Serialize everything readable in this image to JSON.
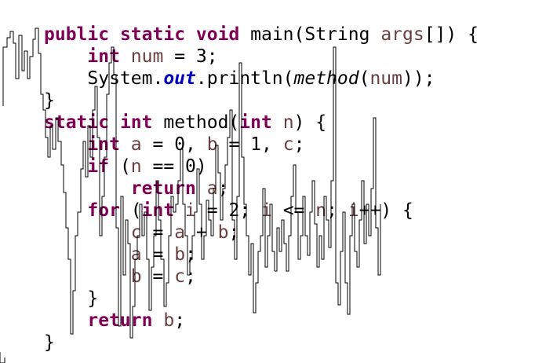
{
  "colors": {
    "background": "#ffffff",
    "keyword": "#7f0055",
    "local_variable": "#6a3e3e",
    "static_field": "#0000c0",
    "plain_text": "#000000",
    "overlay_stroke": "#000000"
  },
  "code": {
    "lines": [
      [
        {
          "t": "public",
          "c": "kw"
        },
        {
          "t": " "
        },
        {
          "t": "static",
          "c": "kw"
        },
        {
          "t": " "
        },
        {
          "t": "void",
          "c": "kw"
        },
        {
          "t": " main(String "
        },
        {
          "t": "args",
          "c": "var"
        },
        {
          "t": "[]) {"
        }
      ],
      [
        {
          "t": "    "
        },
        {
          "t": "int",
          "c": "kw"
        },
        {
          "t": " "
        },
        {
          "t": "num",
          "c": "var"
        },
        {
          "t": " = 3;"
        }
      ],
      [
        {
          "t": "    System."
        },
        {
          "t": "out",
          "c": "field"
        },
        {
          "t": ".println("
        },
        {
          "t": "method",
          "c": "mcall"
        },
        {
          "t": "("
        },
        {
          "t": "num",
          "c": "var"
        },
        {
          "t": "));"
        }
      ],
      [
        {
          "t": "}"
        }
      ],
      [
        {
          "t": "static",
          "c": "kw"
        },
        {
          "t": " "
        },
        {
          "t": "int",
          "c": "kw"
        },
        {
          "t": " method("
        },
        {
          "t": "int",
          "c": "kw"
        },
        {
          "t": " "
        },
        {
          "t": "n",
          "c": "var"
        },
        {
          "t": ") {"
        }
      ],
      [
        {
          "t": "    "
        },
        {
          "t": "int",
          "c": "kw"
        },
        {
          "t": " "
        },
        {
          "t": "a",
          "c": "var"
        },
        {
          "t": " = 0, "
        },
        {
          "t": "b",
          "c": "var"
        },
        {
          "t": " = 1, "
        },
        {
          "t": "c",
          "c": "var"
        },
        {
          "t": ";"
        }
      ],
      [
        {
          "t": "    "
        },
        {
          "t": "if",
          "c": "kw"
        },
        {
          "t": " ("
        },
        {
          "t": "n",
          "c": "var"
        },
        {
          "t": " == 0)"
        }
      ],
      [
        {
          "t": "        "
        },
        {
          "t": "return",
          "c": "kw"
        },
        {
          "t": " "
        },
        {
          "t": "a",
          "c": "var"
        },
        {
          "t": ";"
        }
      ],
      [
        {
          "t": "    "
        },
        {
          "t": "for",
          "c": "kw"
        },
        {
          "t": " ("
        },
        {
          "t": "int",
          "c": "kw"
        },
        {
          "t": " "
        },
        {
          "t": "i",
          "c": "var"
        },
        {
          "t": " = 2; "
        },
        {
          "t": "i",
          "c": "var"
        },
        {
          "t": " <= "
        },
        {
          "t": "n",
          "c": "var"
        },
        {
          "t": "; "
        },
        {
          "t": "i",
          "c": "var"
        },
        {
          "t": "++) {"
        }
      ],
      [
        {
          "t": "        "
        },
        {
          "t": "c",
          "c": "var"
        },
        {
          "t": " = "
        },
        {
          "t": "a",
          "c": "var"
        },
        {
          "t": " + "
        },
        {
          "t": "b",
          "c": "var"
        },
        {
          "t": ";"
        }
      ],
      [
        {
          "t": "        "
        },
        {
          "t": "a",
          "c": "var"
        },
        {
          "t": " = "
        },
        {
          "t": "b",
          "c": "var"
        },
        {
          "t": ";"
        }
      ],
      [
        {
          "t": "        "
        },
        {
          "t": "b",
          "c": "var"
        },
        {
          "t": " = "
        },
        {
          "t": "c",
          "c": "var"
        },
        {
          "t": ";"
        }
      ],
      [
        {
          "t": "    }"
        }
      ],
      [
        {
          "t": "    "
        },
        {
          "t": "return",
          "c": "kw"
        },
        {
          "t": " "
        },
        {
          "t": "b",
          "c": "var"
        },
        {
          "t": ";"
        }
      ],
      [
        {
          "t": "}"
        }
      ]
    ]
  }
}
